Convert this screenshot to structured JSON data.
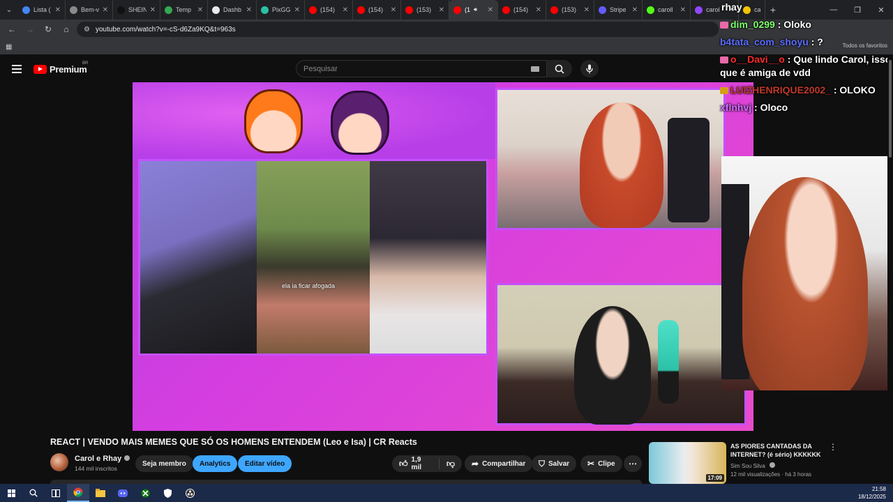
{
  "browser": {
    "tabs": [
      {
        "label": "Lista (",
        "color": "#4285f4"
      },
      {
        "label": "Bem-v",
        "color": "#8a8a8a"
      },
      {
        "label": "SHEIN",
        "color": "#111111"
      },
      {
        "label": "Temp",
        "color": "#34a853"
      },
      {
        "label": "Dashb",
        "color": "#e8eaed"
      },
      {
        "label": "PixGG",
        "color": "#2bc0a5"
      },
      {
        "label": "(154)",
        "color": "#ff0000"
      },
      {
        "label": "(154)",
        "color": "#ff0000"
      },
      {
        "label": "(153)",
        "color": "#ff0000"
      },
      {
        "label": "(1",
        "color": "#ff0000"
      },
      {
        "label": "(154)",
        "color": "#ff0000"
      },
      {
        "label": "(153)",
        "color": "#ff0000"
      },
      {
        "label": "Stripe",
        "color": "#635bff"
      },
      {
        "label": "caroll",
        "color": "#53fc18"
      },
      {
        "label": "carol",
        "color": "#9146ff"
      },
      {
        "label": "carol",
        "color": "#f5c400"
      }
    ],
    "url": "youtube.com/watch?v=-cS-d6Za9KQ&t=963s",
    "all_favorites": "Todos os favoritos"
  },
  "youtube": {
    "logo_text": "Premium",
    "region": "BR",
    "search_placeholder": "Pesquisar"
  },
  "video": {
    "meme_caption": "ela ia ficar afogada",
    "title": "REACT | VENDO MAIS MEMES QUE SÓ OS HOMENS ENTENDEM (Leo e Isa) | CR Reacts",
    "channel_name": "Carol e Rhay",
    "subscribers": "144 mil inscritos",
    "join_label": "Seja membro",
    "analytics_label": "Analytics",
    "edit_label": "Editar vídeo",
    "likes": "1,9 mil",
    "share_label": "Compartilhar",
    "save_label": "Salvar",
    "clip_label": "Clipe"
  },
  "chat": {
    "streamer": "rhay",
    "messages": [
      {
        "user": "dim_0299",
        "message": " : Oloko",
        "color": "#7dff6b",
        "badge": "#e86aa6"
      },
      {
        "user": "b4tata_com_shoyu",
        "message": " : ?",
        "color": "#5a6cff",
        "badge": ""
      },
      {
        "user": "o__Davi__o",
        "message": " : Que lindo Carol, isso que é amiga de vdd",
        "color": "#ff2a2a",
        "badge": "#e86aa6"
      },
      {
        "user": "LUIZHENRIQUE2002_",
        "message": " : OLOKO",
        "color": "#c0392b",
        "badge": "#d4a017"
      },
      {
        "user": "xflnhvj",
        "message": " : Oloco",
        "color": "#d070ff",
        "badge": ""
      }
    ]
  },
  "related": {
    "title": "AS PIORES CANTADAS DA INTERNET? (é sério) KKKKKK",
    "channel": "Sim Sou Silva",
    "views": "12 mil visualizações",
    "age": "há 3 horas",
    "duration": "17:09"
  },
  "taskbar": {
    "time": "21:58",
    "date": "18/12/2025"
  }
}
